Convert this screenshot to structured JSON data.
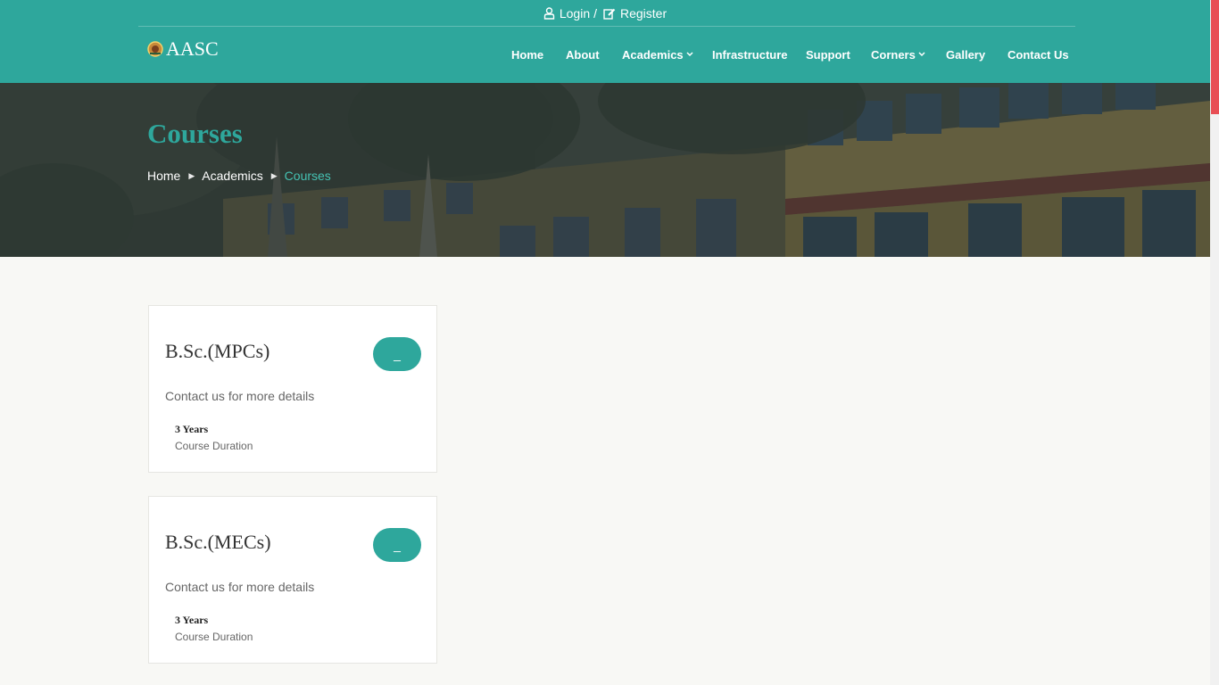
{
  "topbar": {
    "login": "Login",
    "separator": "/",
    "register": "Register"
  },
  "brand": {
    "name": "AASC"
  },
  "nav": {
    "home": "Home",
    "about": "About",
    "academics": "Academics",
    "infrastructure": "Infrastructure",
    "support": "Support",
    "corners": "Corners",
    "gallery": "Gallery",
    "contact": "Contact Us"
  },
  "banner": {
    "title": "Courses",
    "breadcrumb": [
      "Home",
      "Academics",
      "Courses"
    ]
  },
  "courses": [
    {
      "title": "B.Sc.(MPCs)",
      "button": "_",
      "description": "Contact us for more details",
      "duration_value": "3 Years",
      "duration_label": "Course Duration"
    },
    {
      "title": "B.Sc.(MECs)",
      "button": "_",
      "description": "Contact us for more details",
      "duration_value": "3 Years",
      "duration_label": "Course Duration"
    }
  ],
  "colors": {
    "primary": "#2ea79c",
    "breadcrumb_active": "#45c2b3",
    "scroll_thumb": "#e84f55",
    "page_bg": "#f8f8f5"
  }
}
